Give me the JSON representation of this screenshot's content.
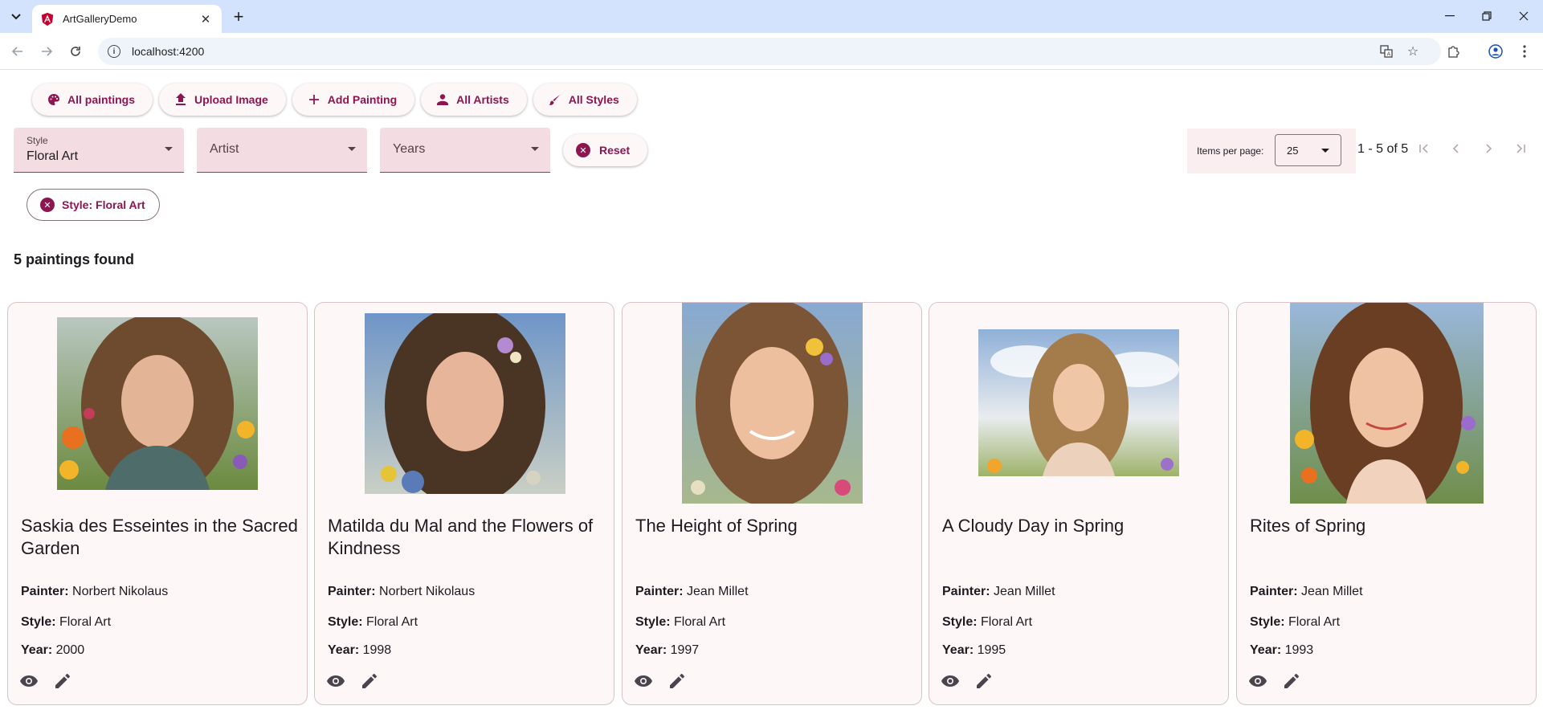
{
  "browser": {
    "tab_title": "ArtGalleryDemo",
    "url": "localhost:4200"
  },
  "nav": [
    {
      "label": "All paintings",
      "icon": "palette-icon"
    },
    {
      "label": "Upload Image",
      "icon": "upload-icon"
    },
    {
      "label": "Add Painting",
      "icon": "plus-icon"
    },
    {
      "label": "All Artists",
      "icon": "person-icon"
    },
    {
      "label": "All Styles",
      "icon": "brush-icon"
    }
  ],
  "filters": {
    "style": {
      "label": "Style",
      "value": "Floral Art"
    },
    "artist": {
      "label": "Artist"
    },
    "years": {
      "label": "Years"
    },
    "reset_label": "Reset"
  },
  "paginator": {
    "items_per_page_label": "Items per page:",
    "page_size": "25",
    "range": "1 - 5 of 5"
  },
  "active_chip": "Style: Floral Art",
  "results_text": "5 paintings found",
  "card_labels": {
    "painter": "Painter:",
    "style": "Style:",
    "year": "Year:"
  },
  "paintings": [
    {
      "title": "Saskia des Esseintes in the Sacred Garden",
      "painter": "Norbert Nikolaus",
      "style": "Floral Art",
      "year": "2000"
    },
    {
      "title": "Matilda du Mal and the Flowers of Kindness",
      "painter": "Norbert Nikolaus",
      "style": "Floral Art",
      "year": "1998"
    },
    {
      "title": "The Height of Spring",
      "painter": "Jean Millet",
      "style": "Floral Art",
      "year": "1997"
    },
    {
      "title": "A Cloudy Day in Spring",
      "painter": "Jean Millet",
      "style": "Floral Art",
      "year": "1995"
    },
    {
      "title": "Rites of Spring",
      "painter": "Jean Millet",
      "style": "Floral Art",
      "year": "1993"
    }
  ],
  "colors": {
    "accent": "#8e1650",
    "field_bg": "#f3dde2",
    "card_bg": "#fdf7f8",
    "tabbar": "#d3e3fd"
  }
}
